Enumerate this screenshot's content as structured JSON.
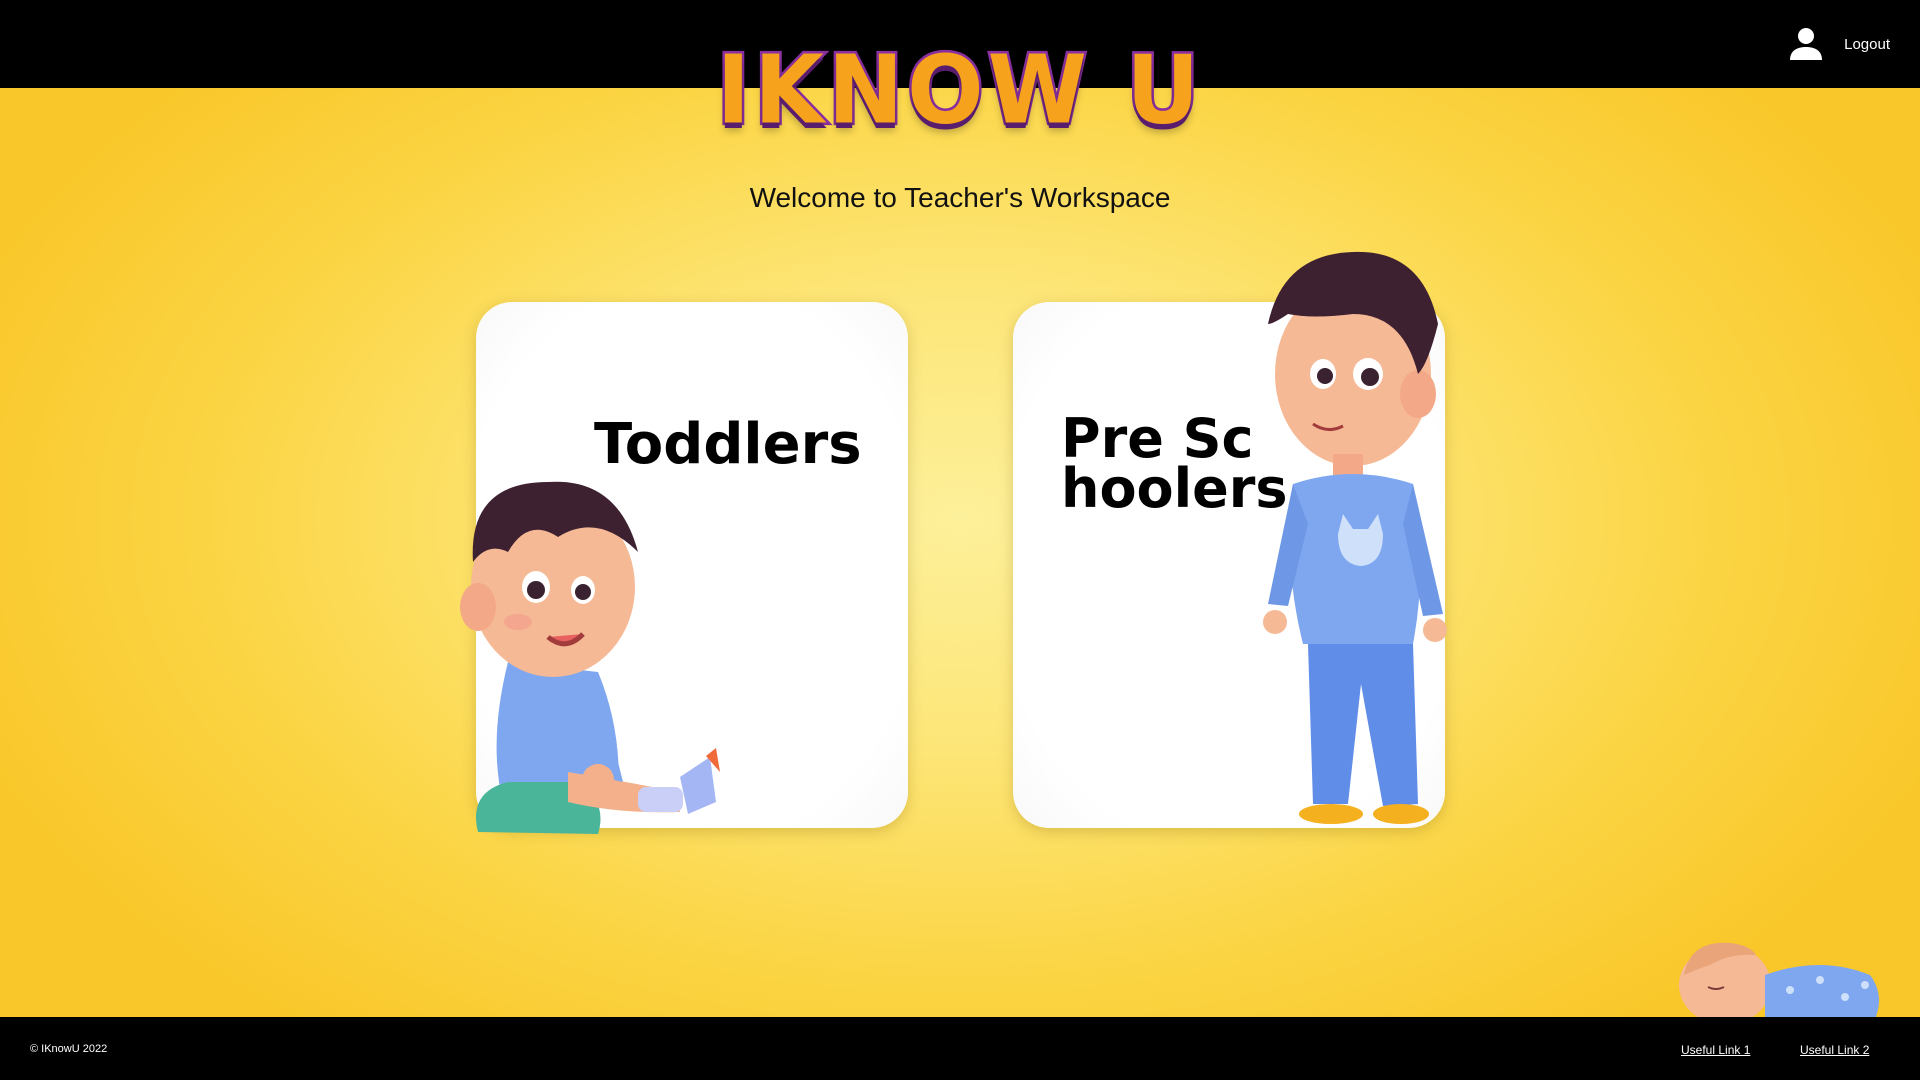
{
  "header": {
    "brand": "IKNOW U",
    "logout_label": "Logout",
    "user_icon": "user-icon"
  },
  "main": {
    "welcome": "Welcome to Teacher's Workspace",
    "cards": [
      {
        "title": "Toddlers"
      },
      {
        "title": "Pre Schoolers"
      }
    ]
  },
  "footer": {
    "copyright": "© IKnowU 2022",
    "links": [
      "Useful Link 1",
      "Useful Link 2"
    ]
  },
  "colors": {
    "bar": "#000000",
    "background": "#fbd545",
    "logo_fill": "#f6a21c",
    "logo_outline": "#8b2fa0"
  }
}
